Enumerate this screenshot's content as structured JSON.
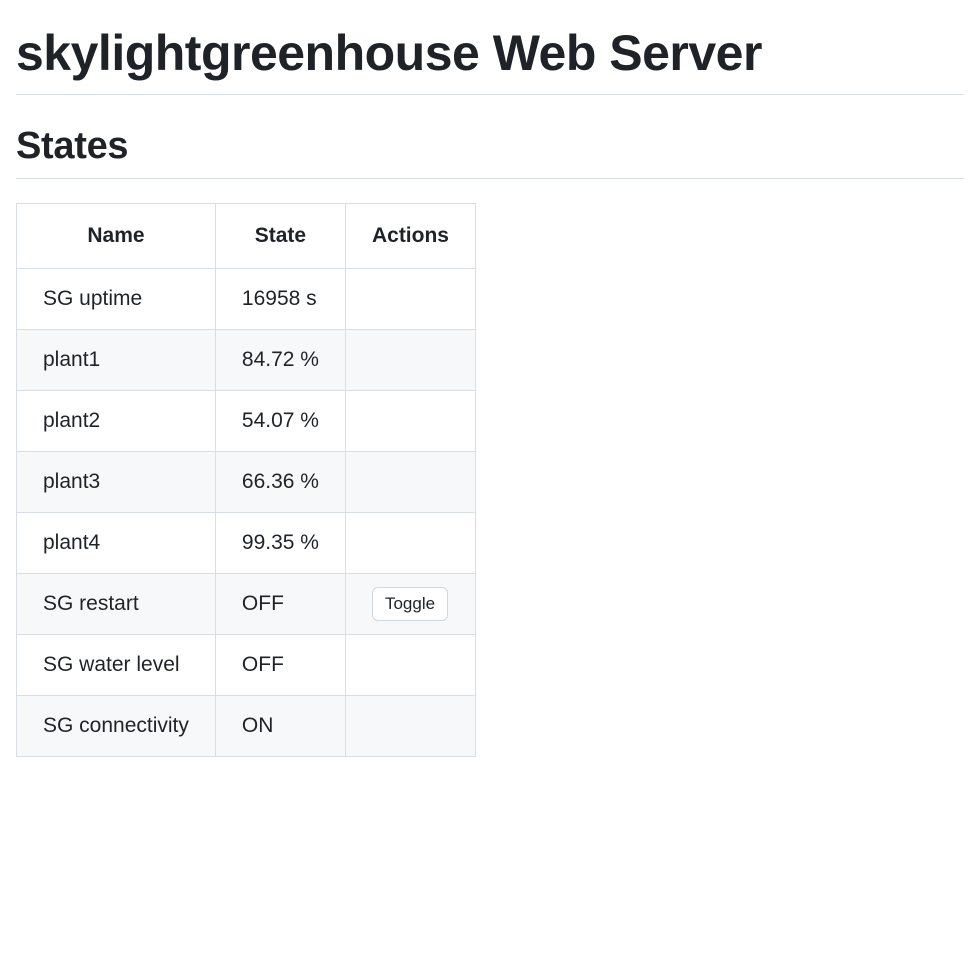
{
  "page": {
    "title": "skylightgreenhouse Web Server",
    "section_title": "States"
  },
  "table": {
    "headers": {
      "name": "Name",
      "state": "State",
      "actions": "Actions"
    },
    "rows": [
      {
        "name": "SG uptime",
        "state": "16958 s",
        "action": null
      },
      {
        "name": "plant1",
        "state": "84.72 %",
        "action": null
      },
      {
        "name": "plant2",
        "state": "54.07 %",
        "action": null
      },
      {
        "name": "plant3",
        "state": "66.36 %",
        "action": null
      },
      {
        "name": "plant4",
        "state": "99.35 %",
        "action": null
      },
      {
        "name": "SG restart",
        "state": "OFF",
        "action": "Toggle"
      },
      {
        "name": "SG water level",
        "state": "OFF",
        "action": null
      },
      {
        "name": "SG connectivity",
        "state": "ON",
        "action": null
      }
    ]
  }
}
